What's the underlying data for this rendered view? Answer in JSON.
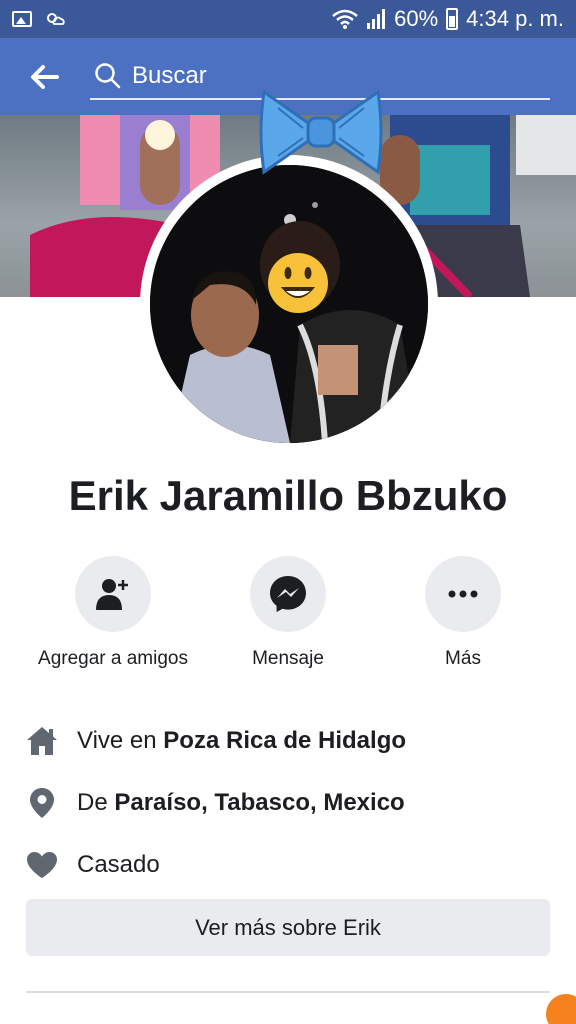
{
  "status_bar": {
    "battery": "60%",
    "time": "4:34 p. m."
  },
  "header": {
    "search_placeholder": "Buscar"
  },
  "profile": {
    "name": "Erik Jaramillo Bbzuko"
  },
  "actions": [
    {
      "label": "Agregar a amigos",
      "icon": "add-friend-icon"
    },
    {
      "label": "Mensaje",
      "icon": "messenger-icon"
    },
    {
      "label": "Más",
      "icon": "more-icon"
    }
  ],
  "info": {
    "lives_prefix": "Vive en ",
    "lives_place": "Poza Rica de Hidalgo",
    "from_prefix": "De ",
    "from_place": "Paraíso, Tabasco, Mexico",
    "relationship": "Casado"
  },
  "more_button": "Ver más sobre Erik",
  "colors": {
    "status_bar": "#3b5998",
    "header": "#4c70c2",
    "button_bg": "#e9ebee",
    "icon_gray": "#606770"
  }
}
